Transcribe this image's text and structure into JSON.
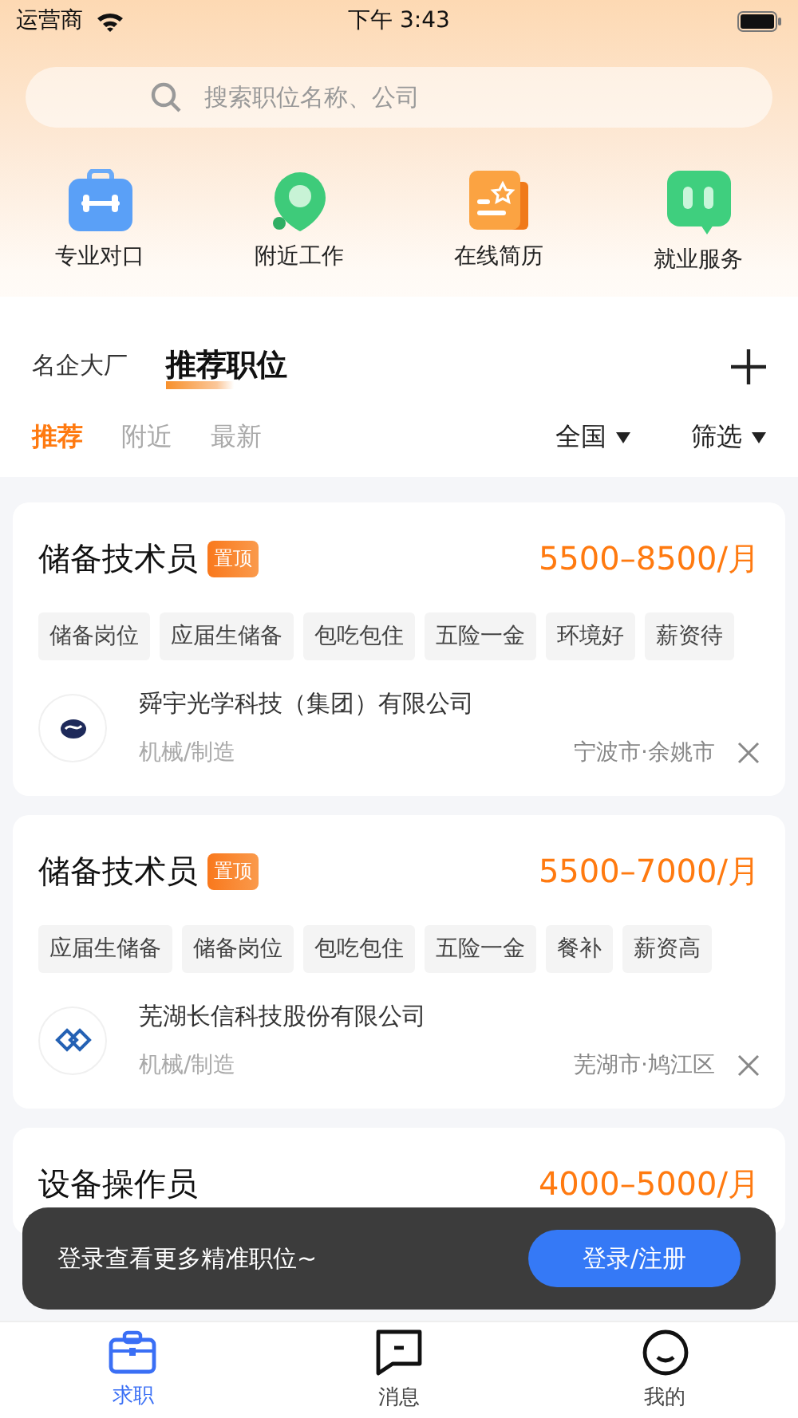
{
  "status_bar": {
    "carrier": "运营商",
    "time": "下午 3:43"
  },
  "search": {
    "placeholder": "搜索职位名称、公司"
  },
  "shortcuts": [
    {
      "kind": "toolbox",
      "label": "专业对口"
    },
    {
      "kind": "pin",
      "label": "附近工作"
    },
    {
      "kind": "resume",
      "label": "在线简历"
    },
    {
      "kind": "chat",
      "label": "就业服务"
    }
  ],
  "section_tabs": [
    {
      "label": "名企大厂",
      "selected": false
    },
    {
      "label": "推荐职位",
      "selected": true
    }
  ],
  "filter_tabs": [
    {
      "label": "推荐",
      "selected": true
    },
    {
      "label": "附近",
      "selected": false
    },
    {
      "label": "最新",
      "selected": false
    }
  ],
  "dropdowns": [
    {
      "label": "全国"
    },
    {
      "label": "筛选"
    }
  ],
  "jobs": [
    {
      "title": "储备技术员",
      "badge": "置顶",
      "salary": "5500–8500/月",
      "tags": [
        "储备岗位",
        "应届生储备",
        "包吃包住",
        "五险一金",
        "环境好",
        "薪资待"
      ],
      "logo": {
        "kind": "swirl"
      },
      "company": "舜宇光学科技（集团）有限公司",
      "industry": "机械/制造",
      "location": "宁波市·余姚市"
    },
    {
      "title": "储备技术员",
      "badge": "置顶",
      "salary": "5500–7000/月",
      "tags": [
        "应届生储备",
        "储备岗位",
        "包吃包住",
        "五险一金",
        "餐补",
        "薪资高"
      ],
      "logo": {
        "kind": "diamond"
      },
      "company": "芜湖长信科技股份有限公司",
      "industry": "机械/制造",
      "location": "芜湖市·鸠江区"
    },
    {
      "title": "设备操作员",
      "salary": "4000–5000/月"
    }
  ],
  "toast": {
    "message": "登录查看更多精准职位~",
    "button": "登录/注册"
  },
  "bottom_nav": [
    {
      "kind": "briefcase",
      "label": "求职",
      "selected": true
    },
    {
      "kind": "message",
      "label": "消息",
      "selected": false
    },
    {
      "kind": "face",
      "label": "我的",
      "selected": false
    }
  ]
}
